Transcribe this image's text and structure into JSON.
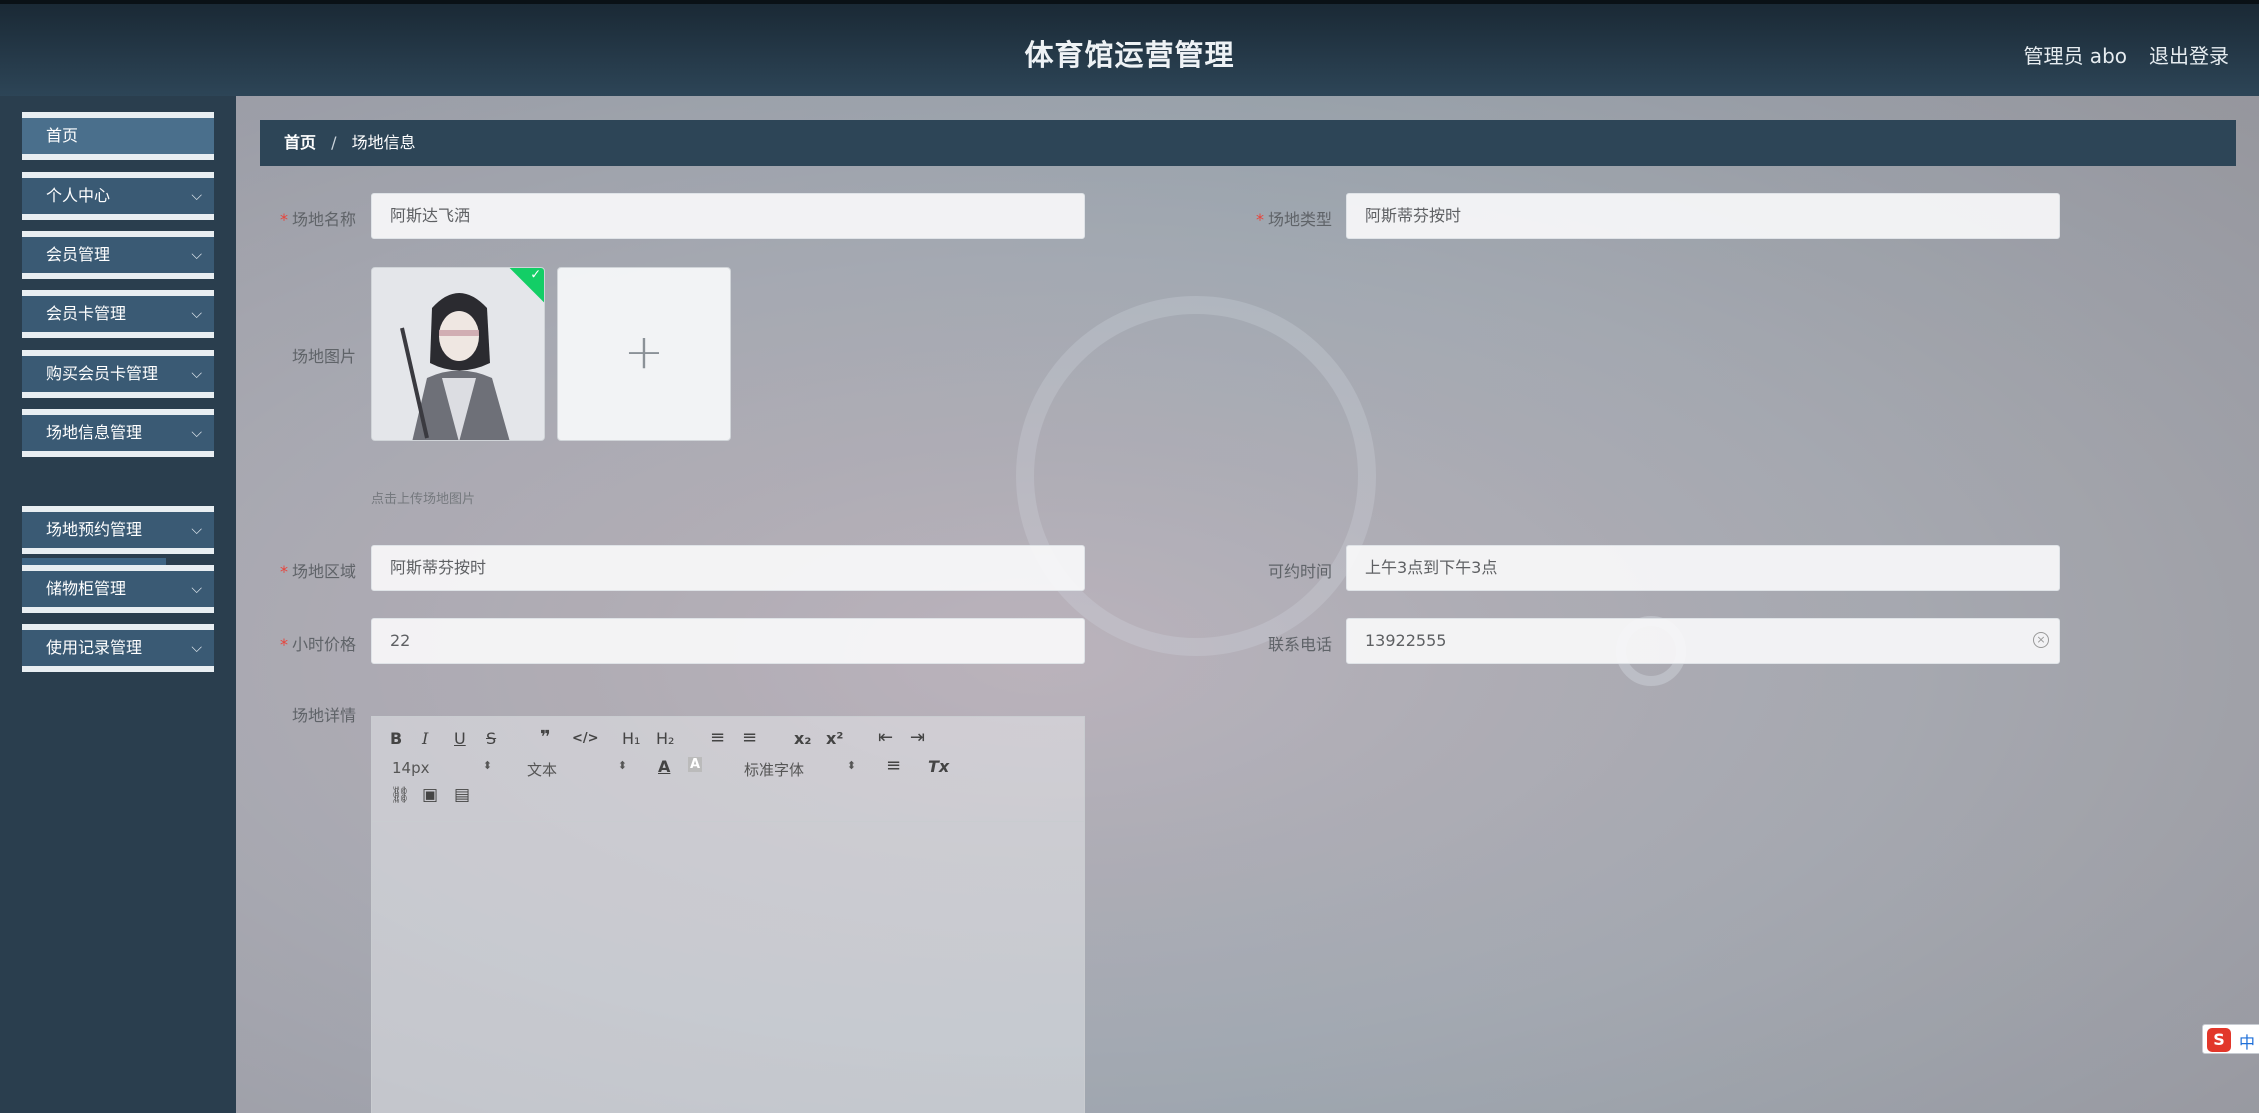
{
  "header": {
    "title": "体育馆运营管理",
    "user": "管理员 abo",
    "logout": "退出登录"
  },
  "sidebar": {
    "items": [
      {
        "label": "首页"
      },
      {
        "label": "个人中心"
      },
      {
        "label": "会员管理"
      },
      {
        "label": "会员卡管理"
      },
      {
        "label": "购买会员卡管理"
      },
      {
        "label": "场地信息管理"
      },
      {
        "label": "场地预约管理"
      },
      {
        "label": "储物柜管理"
      },
      {
        "label": "使用记录管理"
      }
    ],
    "active_sub": "场地信息",
    "chevron": "chevron-down-icon"
  },
  "breadcrumb": {
    "home": "首页",
    "separator": "/",
    "current": "场地信息"
  },
  "form": {
    "name": {
      "label": "场地名称",
      "value": "阿斯达飞洒"
    },
    "type": {
      "label": "场地类型",
      "value": "阿斯蒂芬按时"
    },
    "image": {
      "label": "场地图片",
      "tip": "点击上传场地图片",
      "add": "+"
    },
    "area": {
      "label": "场地区域",
      "value": "阿斯蒂芬按时"
    },
    "time": {
      "label": "可约时间",
      "value": "上午3点到下午3点"
    },
    "price": {
      "label": "小时价格",
      "value": "22"
    },
    "phone": {
      "label": "联系电话",
      "value": "13922555"
    },
    "detail": {
      "label": "场地详情"
    },
    "required_mark": "*"
  },
  "editor_toolbar": {
    "bold": "B",
    "italic": "I",
    "underline": "U",
    "strike": "S",
    "quote": "❞",
    "code": "</>",
    "h1": "H₁",
    "h2": "H₂",
    "ol": "≡",
    "ul": "≡",
    "sub": "x₂",
    "sup": "x²",
    "outdent": "⇤",
    "indent": "⇥",
    "size": "14px",
    "header": "文本",
    "font": "标准字体",
    "color": "A",
    "bg": "A",
    "align": "≡",
    "clean": "Tx",
    "link": "⛓",
    "image": "▣",
    "video": "▤"
  },
  "ime": {
    "logo": "S",
    "lang": "中",
    "moon": "☽",
    "punct": "°,",
    "kbd": "⌨",
    "person": "☺",
    "shirt": "👕",
    "tool": "🔧"
  },
  "colors": {
    "header": "#243746",
    "sidebar": "#2a3e4e",
    "menu": "#3a5a74",
    "required": "#e8433a",
    "upload_ok": "#13ce66"
  }
}
